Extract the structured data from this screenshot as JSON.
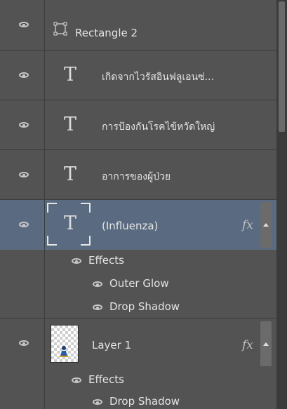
{
  "layers": [
    {
      "name": "Rectangle 2",
      "kind": "shape",
      "icon": "shape-layer-icon"
    },
    {
      "name": "เกิดจากไวรัสอินฟลูเอนซ่...",
      "kind": "text",
      "icon": "text-layer-T-icon"
    },
    {
      "name": "การป้องกันโรคไข้หวัดใหญ่",
      "kind": "text",
      "icon": "text-layer-T-icon"
    },
    {
      "name": "อาการของผู้ป่วย",
      "kind": "text",
      "icon": "text-layer-T-icon"
    },
    {
      "name": "(Influenza)",
      "kind": "text",
      "selected": true,
      "icon": "text-layer-T-icon",
      "fx": "fx",
      "effects_label": "Effects",
      "effects": [
        "Outer Glow",
        "Drop Shadow"
      ]
    },
    {
      "name": "Layer 1",
      "kind": "raster",
      "icon": "layer-thumbnail",
      "fx": "fx",
      "effects_label": "Effects",
      "effects": [
        "Drop Shadow"
      ]
    }
  ],
  "colors": {
    "panel": "#535353",
    "selected": "#5a6b81",
    "divider": "#3c3c3c"
  }
}
